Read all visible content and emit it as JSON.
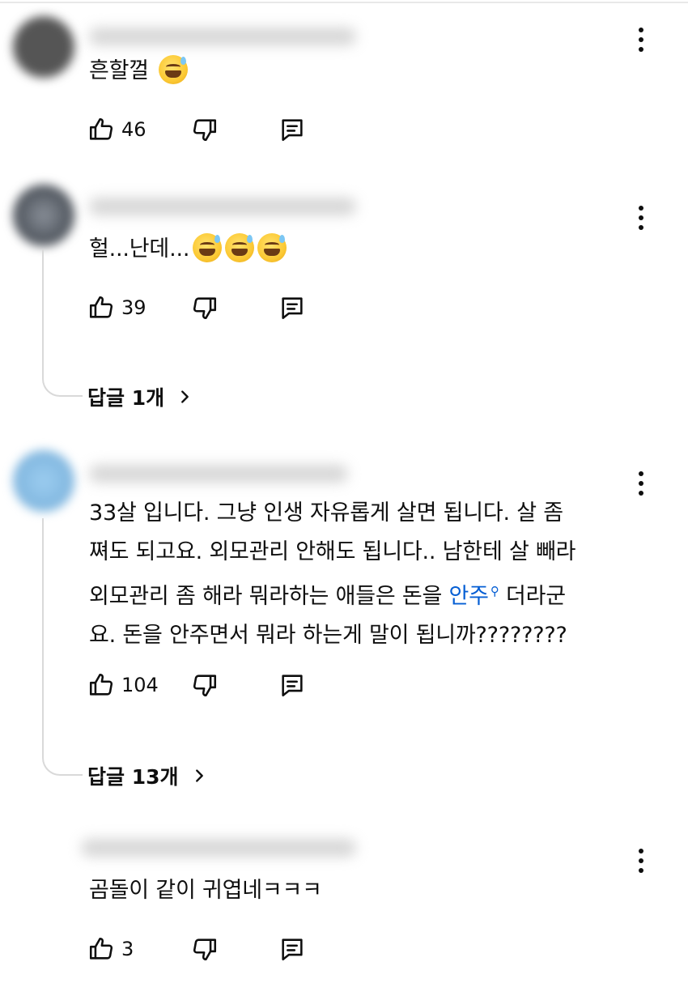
{
  "icons": {
    "like": "thumbs-up-icon",
    "dislike": "thumbs-down-icon",
    "reply": "reply-comment-icon",
    "more": "more-vertical-icon",
    "chevron": "chevron-right-icon"
  },
  "colors": {
    "link": "#065fd4",
    "text": "#0f0f0f",
    "thread_line": "#d9d9d9"
  },
  "comments": [
    {
      "text": "흔할껄 ",
      "emojis": [
        "laughing-tears-emoji"
      ],
      "likes": "46"
    },
    {
      "text": "헐...난데...",
      "emojis": [
        "grin-sweat-emoji",
        "grin-sweat-emoji",
        "grin-sweat-emoji"
      ],
      "likes": "39",
      "replies_label": "답글 1개"
    },
    {
      "text_before_link": "33살 입니다. 그냥 인생 자유롭게 살면 됩니다. 살 좀\n쪄도 되고요. 외모관리 안해도 됩니다.. 남한테 살 빼라\n외모관리 좀 해라 뭐라하는 애들은 돈을 ",
      "link_text": "안주",
      "link_icon": "search-small-icon",
      "text_after_link": " 더라군\n요. 돈을 안주면서 뭐라 하는게 말이 됩니까????????",
      "likes": "104",
      "replies_label": "답글 13개"
    },
    {
      "text": "곰돌이 같이 귀엽네ㅋㅋㅋ",
      "likes": "3"
    }
  ]
}
